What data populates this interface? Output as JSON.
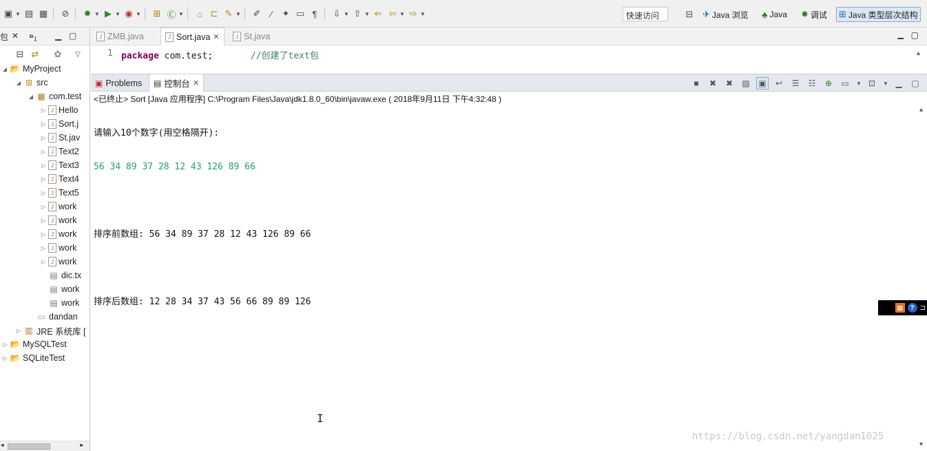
{
  "toolbar": {
    "icons": [
      "new-icon",
      "save-icon",
      "print-icon",
      "skip-breakpoints-icon",
      "debug-icon",
      "run-icon",
      "run-external-icon",
      "new-java-project-icon",
      "new-class-icon",
      "open-type-icon",
      "open-task-icon",
      "search-icon",
      "annotation-icon",
      "pin-icon",
      "toggle-mark-icon",
      "block-select-icon",
      "whitespace-icon",
      "next-annotation-icon",
      "prev-annotation-icon",
      "last-edit-icon",
      "back-icon",
      "forward-icon"
    ],
    "quick_access": "快速访问",
    "perspectives": [
      {
        "label": "Java 浏览",
        "icon": "java-browsing-icon"
      },
      {
        "label": "Java",
        "icon": "java-perspective-icon"
      },
      {
        "label": "调试",
        "icon": "debug-perspective-icon"
      },
      {
        "label": "Java 类型层次结构",
        "icon": "type-hierarchy-icon"
      }
    ]
  },
  "explorer": {
    "tab_label": "包",
    "tab2_label": "»",
    "tab2_count": "1",
    "items": [
      {
        "label": "MyProject",
        "icon": "project-icon"
      },
      {
        "label": "src",
        "icon": "source-folder-icon"
      },
      {
        "label": "com.test",
        "icon": "package-icon"
      },
      {
        "label": "Hello",
        "icon": "java-file-icon"
      },
      {
        "label": "Sort.j",
        "icon": "java-file-icon"
      },
      {
        "label": "St.jav",
        "icon": "java-file-icon"
      },
      {
        "label": "Text2",
        "icon": "java-file-icon"
      },
      {
        "label": "Text3",
        "icon": "java-file-icon"
      },
      {
        "label": "Text4",
        "icon": "java-file-icon"
      },
      {
        "label": "Text5",
        "icon": "java-file-icon"
      },
      {
        "label": "work",
        "icon": "java-file-icon"
      },
      {
        "label": "work",
        "icon": "java-file-icon"
      },
      {
        "label": "work",
        "icon": "java-file-icon"
      },
      {
        "label": "work",
        "icon": "java-file-icon"
      },
      {
        "label": "work",
        "icon": "java-file-icon"
      },
      {
        "label": "dic.tx",
        "icon": "text-file-icon"
      },
      {
        "label": "work",
        "icon": "text-file-icon"
      },
      {
        "label": "work",
        "icon": "text-file-icon"
      },
      {
        "label": "dandan",
        "icon": "folder-icon"
      },
      {
        "label": "JRE 系统库 [",
        "icon": "library-icon"
      },
      {
        "label": "MySQLTest",
        "icon": "project-icon"
      },
      {
        "label": "SQLiteTest",
        "icon": "project-icon"
      }
    ]
  },
  "editor": {
    "tabs": [
      {
        "label": "ZMB.java",
        "active": false
      },
      {
        "label": "Sort.java",
        "active": true
      },
      {
        "label": "St.java",
        "active": false
      }
    ],
    "line_number": "1",
    "code_keyword": "package",
    "code_rest": " com.test;",
    "code_comment": "//创建了text包"
  },
  "console": {
    "tabs": [
      {
        "label": "Problems",
        "active": false
      },
      {
        "label": "控制台",
        "active": true
      }
    ],
    "status": "<已终止> Sort [Java 应用程序] C:\\Program Files\\Java\\jdk1.8.0_60\\bin\\javaw.exe ( 2018年9月11日 下午4:32:48 )",
    "lines": [
      {
        "text": "请输入10个数字(用空格隔开):",
        "color": "#111111"
      },
      {
        "text": "56 34 89 37 28 12 43 126 89 66",
        "color": "#21a07a"
      },
      {
        "text": "",
        "color": "#111111"
      },
      {
        "text": "排序前数组: 56 34 89 37 28 12 43 126 89 66",
        "color": "#111111"
      },
      {
        "text": "",
        "color": "#111111"
      },
      {
        "text": "排序后数组: 12 28 34 37 43 56 66 89 89 126",
        "color": "#111111"
      }
    ]
  },
  "watermark": "https://blog.csdn.net/yangdan1025"
}
